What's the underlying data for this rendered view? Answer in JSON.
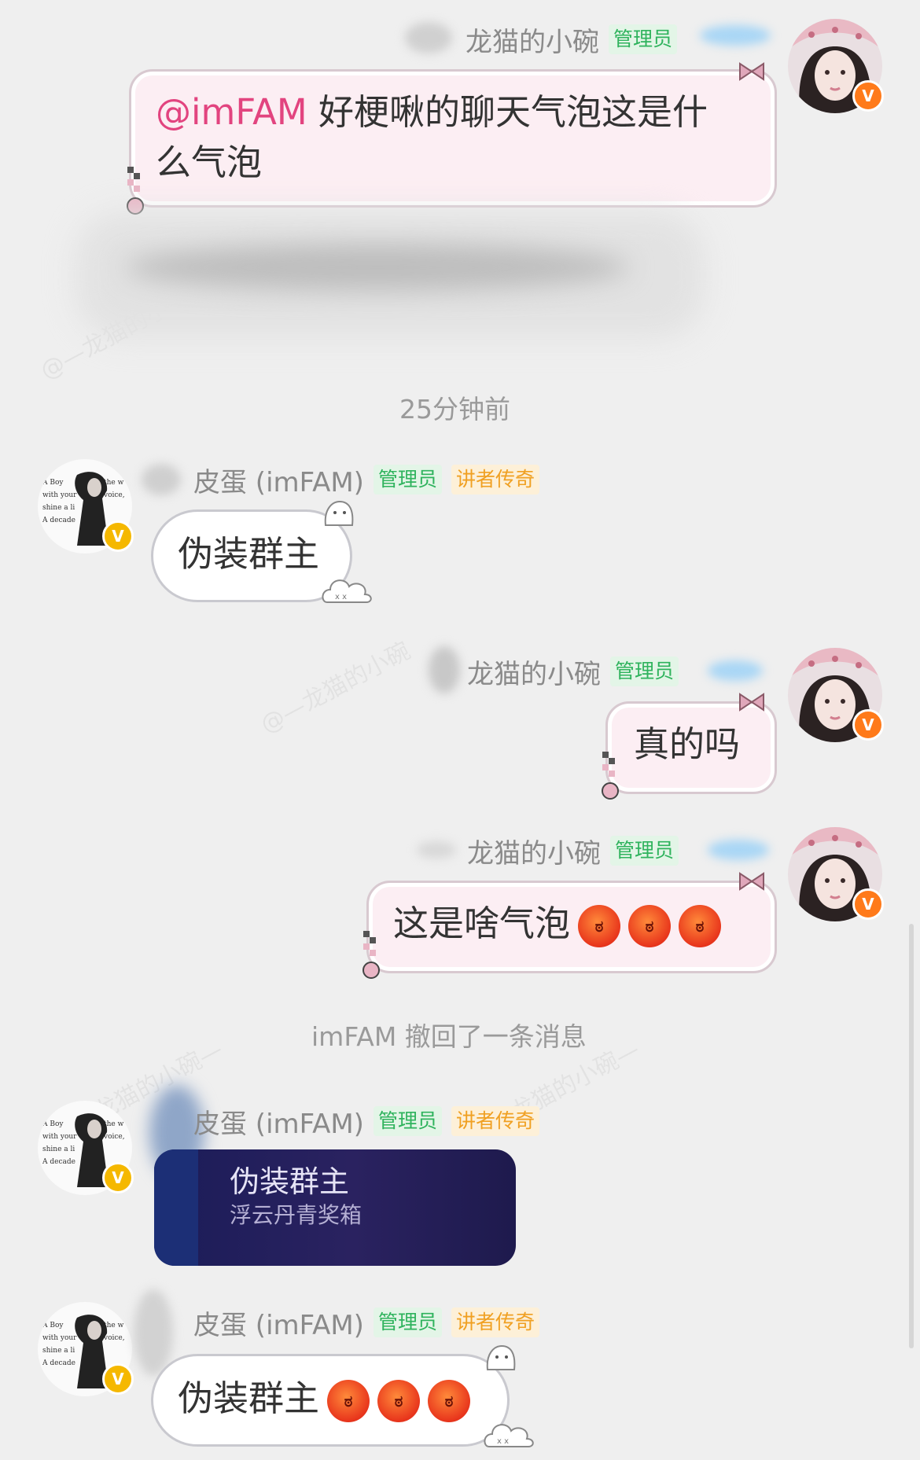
{
  "users": {
    "me": {
      "name": "龙猫的小碗",
      "tag": "管理员"
    },
    "other": {
      "name": "皮蛋 (imFAM)",
      "tag1": "管理员",
      "tag2": "讲者传奇"
    }
  },
  "messages": {
    "m1": {
      "mention": "@imFAM",
      "line1": " 好梗啾的聊天气泡这是什",
      "line2": "么气泡"
    },
    "timestamp": "25分钟前",
    "m2": {
      "text": "伪装群主"
    },
    "m3": {
      "text": "真的吗"
    },
    "m4": {
      "text": "这是啥气泡"
    },
    "recall": "imFAM 撤回了一条消息",
    "m5": {
      "title": "伪装群主",
      "subtitle": "浮云丹青奖箱"
    },
    "m6": {
      "text": "伪装群主"
    }
  },
  "watermarks": [
    "@—龙猫的小碗",
    "@—龙猫的小碗",
    "龙猫的小碗—",
    "龙猫的小碗—"
  ],
  "colors": {
    "background": "#efefef",
    "mention": "#e2447f",
    "admin_tag": "#2fb35d",
    "legend_tag": "#f0a022",
    "me_badge": "#ff7a1a",
    "other_badge": "#f5b800"
  }
}
